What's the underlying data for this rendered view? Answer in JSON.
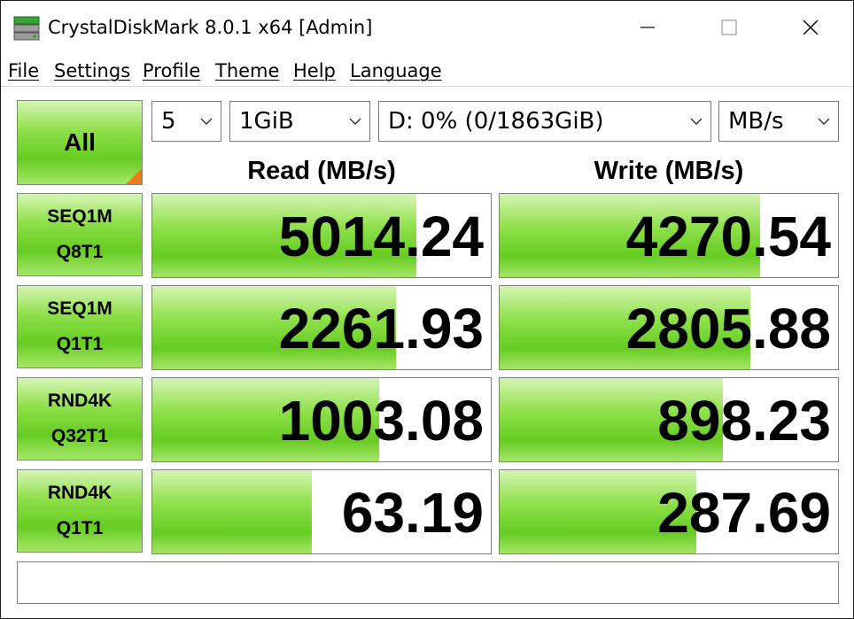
{
  "window": {
    "title": "CrystalDiskMark 8.0.1 x64 [Admin]",
    "controls": [
      "minimize-icon",
      "maximize-icon",
      "close-icon"
    ]
  },
  "menu": {
    "items": [
      "File",
      "Settings",
      "Profile",
      "Theme",
      "Help",
      "Language"
    ]
  },
  "toolbar": {
    "all_label": "All",
    "count": "5",
    "size": "1GiB",
    "drive": "D: 0% (0/1863GiB)",
    "unit": "MB/s"
  },
  "headers": {
    "read": "Read (MB/s)",
    "write": "Write (MB/s)"
  },
  "tests": [
    {
      "line1": "SEQ1M",
      "line2": "Q8T1",
      "read": "5014.24",
      "write": "4270.54",
      "read_fill": 0.78,
      "write_fill": 0.77
    },
    {
      "line1": "SEQ1M",
      "line2": "Q1T1",
      "read": "2261.93",
      "write": "2805.88",
      "read_fill": 0.72,
      "write_fill": 0.74
    },
    {
      "line1": "RND4K",
      "line2": "Q32T1",
      "read": "1003.08",
      "write": "898.23",
      "read_fill": 0.67,
      "write_fill": 0.66
    },
    {
      "line1": "RND4K",
      "line2": "Q1T1",
      "read": "63.19",
      "write": "287.69",
      "read_fill": 0.47,
      "write_fill": 0.58
    }
  ],
  "comment": "",
  "colors": {
    "bar_green": "#66cc22",
    "corner_orange": "#f07a1a"
  }
}
